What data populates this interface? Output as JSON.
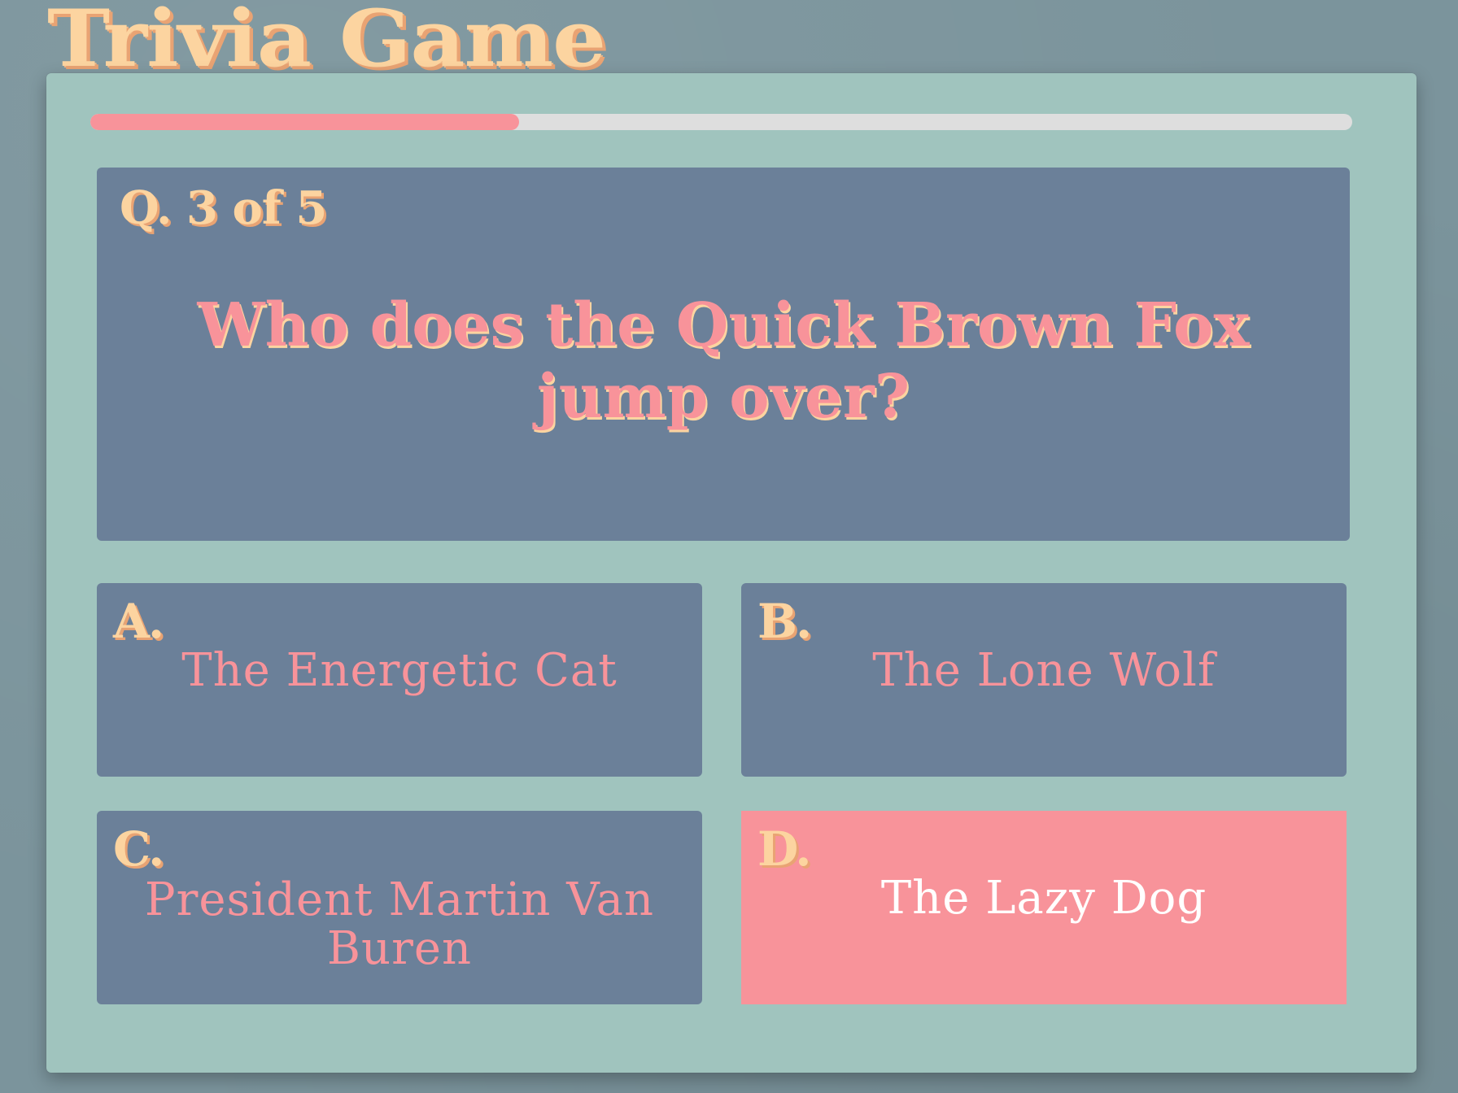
{
  "app": {
    "title": "Trivia Game"
  },
  "progress": {
    "fraction": 0.34,
    "fill_color": "#f8939a",
    "track_color": "#dedede"
  },
  "question": {
    "counter": "Q. 3 of 5",
    "text": "Who does the Quick Brown Fox jump over?"
  },
  "answers": [
    {
      "letter": "A.",
      "text": "The Energetic Cat",
      "selected": false
    },
    {
      "letter": "B.",
      "text": "The Lone Wolf",
      "selected": false
    },
    {
      "letter": "C.",
      "text": "President Martin Van Buren",
      "selected": false
    },
    {
      "letter": "D.",
      "text": "The Lazy Dog",
      "selected": true
    }
  ],
  "colors": {
    "background": "#7b949c",
    "card": "#a0c4be",
    "panel": "#6b8099",
    "accent": "#f8939a",
    "title": "#fcd4a0"
  }
}
